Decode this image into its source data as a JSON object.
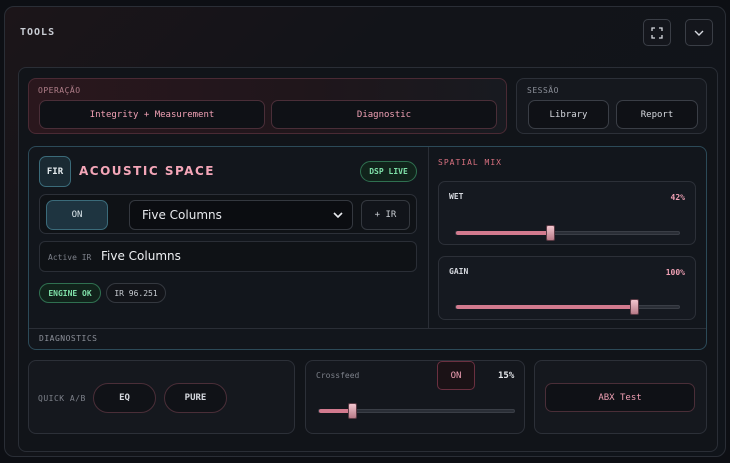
{
  "header": {
    "title": "TOOLS",
    "icons": [
      "fullscreen-icon",
      "chevron-down-icon"
    ]
  },
  "operacao": {
    "label": "OPERAÇÃO",
    "buttons": [
      "Integrity + Measurement",
      "Diagnostic"
    ]
  },
  "sessao": {
    "label": "SESSÃO",
    "buttons": [
      "Library",
      "Report"
    ]
  },
  "acoustic": {
    "fir_label": "FIR",
    "title": "ACOUSTIC SPACE",
    "dsp_badge": "DSP LIVE",
    "on_label": "ON",
    "selected_ir": "Five Columns",
    "add_ir_label": "+ IR",
    "active_ir_key": "Active IR",
    "active_ir_value": "Five Columns",
    "engine_badge": "ENGINE OK",
    "ir_badge": "IR 96.251",
    "diagnostics_label": "DIAGNOSTICS"
  },
  "spatial": {
    "title": "SPATIAL MIX",
    "wet": {
      "label": "WET",
      "value_text": "42%",
      "value": 0.42
    },
    "gain": {
      "label": "GAIN",
      "value_text": "100%",
      "value": 0.8
    }
  },
  "quick_ab": {
    "label": "QUICK A/B",
    "buttons": [
      "EQ",
      "PURE"
    ]
  },
  "crossfeed": {
    "label": "Crossfeed",
    "on_label": "ON",
    "value_text": "15%",
    "value": 0.17
  },
  "abx": {
    "label": "ABX Test"
  },
  "colors": {
    "accent_pink": "#f0a0b4",
    "accent_teal": "#3b6b7a",
    "status_green": "#7fe0a8"
  }
}
